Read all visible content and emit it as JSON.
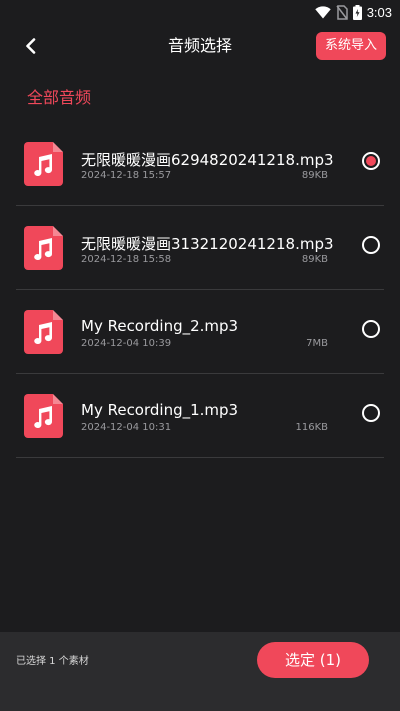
{
  "status_bar": {
    "time": "3:03"
  },
  "header": {
    "back_icon": "chevron-left-icon",
    "title": "音频选择",
    "import_label": "系统导入"
  },
  "section": {
    "title": "全部音频"
  },
  "audio_list": [
    {
      "name": "无限暖暖漫画6294820241218.mp3",
      "date": "2024-12-18 15:57",
      "size": "89KB",
      "selected": true
    },
    {
      "name": "无限暖暖漫画3132120241218.mp3",
      "date": "2024-12-18 15:58",
      "size": "89KB",
      "selected": false
    },
    {
      "name": "My Recording_2.mp3",
      "date": "2024-12-04 10:39",
      "size": "7MB",
      "selected": false
    },
    {
      "name": "My Recording_1.mp3",
      "date": "2024-12-04 10:31",
      "size": "116KB",
      "selected": false
    }
  ],
  "bottom_bar": {
    "selected_text": "已选择 1 个素材",
    "confirm_label": "选定 (1)"
  },
  "colors": {
    "accent": "#f0485a",
    "background": "#1c1c1e",
    "bottom_bar": "#2c2c2e"
  }
}
